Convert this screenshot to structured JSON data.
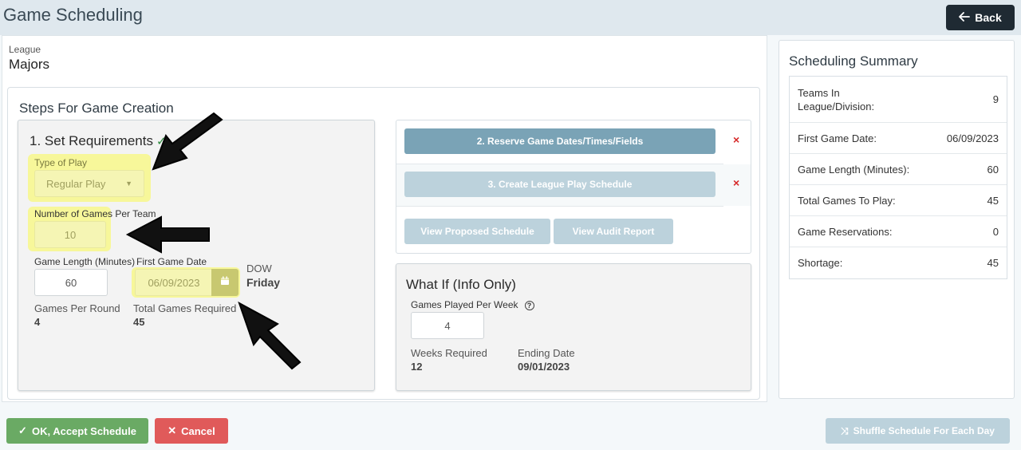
{
  "header": {
    "title": "Game Scheduling",
    "back_label": "Back"
  },
  "league": {
    "label": "League",
    "value": "Majors"
  },
  "steps": {
    "title": "Steps For Game Creation",
    "requirements": {
      "title": "1. Set Requirements",
      "type_of_play": {
        "label": "Type of Play",
        "value": "Regular Play"
      },
      "games_per_team": {
        "label": "Number of Games Per Team",
        "value": "10"
      },
      "game_length": {
        "label": "Game Length (Minutes)",
        "value": "60"
      },
      "first_game_date": {
        "label": "First Game Date",
        "value": "06/09/2023"
      },
      "dow": {
        "label": "DOW",
        "value": "Friday"
      },
      "games_per_round": {
        "label": "Games Per Round",
        "value": "4"
      },
      "total_games_required": {
        "label": "Total Games Required",
        "value": "45"
      }
    },
    "actions": {
      "reserve_label": "2. Reserve Game Dates/Times/Fields",
      "create_label": "3. Create League Play Schedule",
      "view_proposed_label": "View Proposed Schedule",
      "view_audit_label": "View Audit Report",
      "x_mark": "×"
    },
    "what_if": {
      "title": "What If (Info Only)",
      "games_per_week": {
        "label": "Games Played Per Week",
        "value": "4"
      },
      "weeks_required": {
        "label": "Weeks Required",
        "value": "12"
      },
      "ending_date": {
        "label": "Ending Date",
        "value": "09/01/2023"
      }
    }
  },
  "summary": {
    "title": "Scheduling Summary",
    "rows": [
      {
        "label": "Teams In League/Division:",
        "value": "9"
      },
      {
        "label": "First Game Date:",
        "value": "06/09/2023"
      },
      {
        "label": "Game Length (Minutes):",
        "value": "60"
      },
      {
        "label": "Total Games To Play:",
        "value": "45"
      },
      {
        "label": "Game Reservations:",
        "value": "0"
      },
      {
        "label": "Shortage:",
        "value": "45"
      }
    ]
  },
  "footer": {
    "accept_label": "OK, Accept Schedule",
    "cancel_label": "Cancel",
    "shuffle_label": "Shuffle Schedule For Each Day"
  },
  "colors": {
    "highlight": "#f7f79a",
    "primary_button": "#7aa3b6",
    "accept_button": "#6aaa64",
    "cancel_button": "#e05a5a",
    "shuffle_button": "#bcd2dc",
    "back_button": "#1f2a33"
  }
}
